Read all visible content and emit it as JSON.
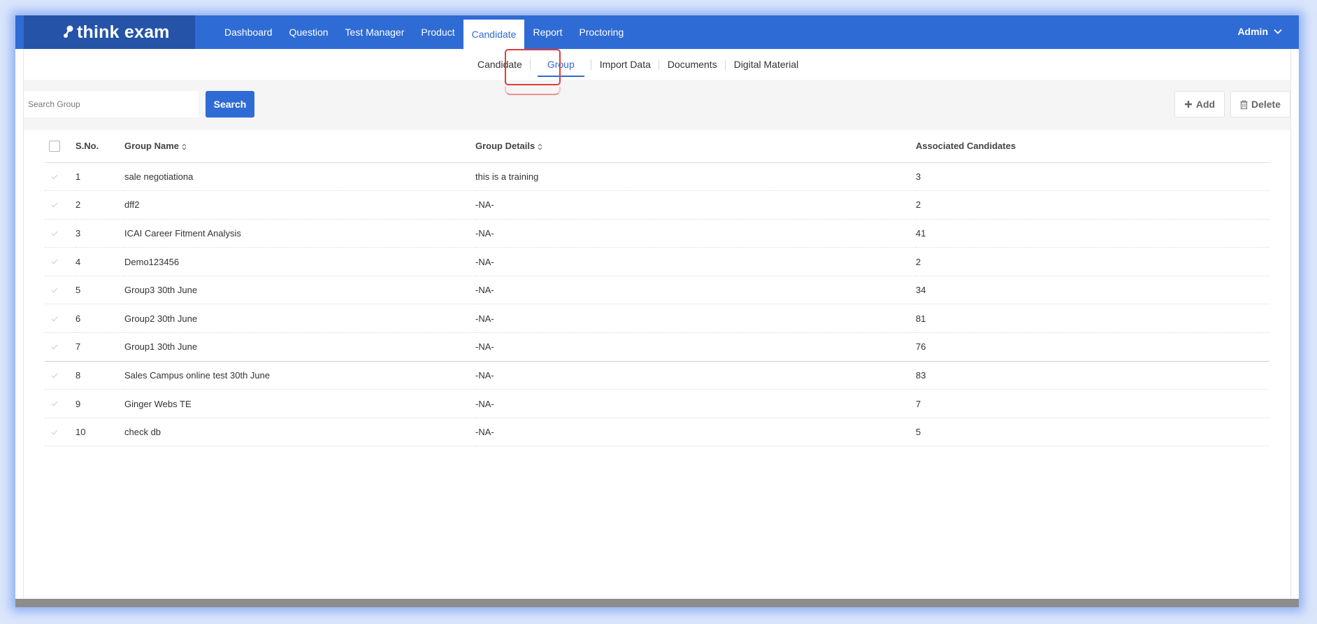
{
  "brand": {
    "name": "think exam"
  },
  "nav": {
    "items": [
      {
        "label": "Dashboard"
      },
      {
        "label": "Question"
      },
      {
        "label": "Test Manager"
      },
      {
        "label": "Product"
      },
      {
        "label": "Candidate"
      },
      {
        "label": "Report"
      },
      {
        "label": "Proctoring"
      }
    ],
    "active": "Candidate",
    "user": "Admin"
  },
  "subnav": {
    "items": [
      {
        "label": "Candidate"
      },
      {
        "label": "Group"
      },
      {
        "label": "Import Data"
      },
      {
        "label": "Documents"
      },
      {
        "label": "Digital Material"
      }
    ],
    "active": "Group"
  },
  "toolbar": {
    "search_placeholder": "Search Group",
    "search_label": "Search",
    "add_label": "Add",
    "delete_label": "Delete"
  },
  "table": {
    "headers": {
      "sno": "S.No.",
      "group_name": "Group Name",
      "group_details": "Group Details",
      "associated": "Associated Candidates"
    },
    "rows": [
      {
        "sno": "1",
        "name": "sale negotiationa",
        "details": "this is a training",
        "associated": "3"
      },
      {
        "sno": "2",
        "name": "dff2",
        "details": "-NA-",
        "associated": "2"
      },
      {
        "sno": "3",
        "name": "ICAI Career Fitment Analysis",
        "details": "-NA-",
        "associated": "41"
      },
      {
        "sno": "4",
        "name": "Demo123456",
        "details": "-NA-",
        "associated": "2"
      },
      {
        "sno": "5",
        "name": "Group3 30th June",
        "details": "-NA-",
        "associated": "34"
      },
      {
        "sno": "6",
        "name": "Group2 30th June",
        "details": "-NA-",
        "associated": "81"
      },
      {
        "sno": "7",
        "name": "Group1 30th June",
        "details": "-NA-",
        "associated": "76"
      },
      {
        "sno": "8",
        "name": "Sales Campus online test 30th June",
        "details": "-NA-",
        "associated": "83"
      },
      {
        "sno": "9",
        "name": "Ginger Webs TE",
        "details": "-NA-",
        "associated": "7"
      },
      {
        "sno": "10",
        "name": "check db",
        "details": "-NA-",
        "associated": "5"
      }
    ]
  },
  "colors": {
    "primary": "#2f6bd4",
    "logo_bg": "#2453a8",
    "highlight": "#e03c3c"
  },
  "icons": {
    "add": "plus-icon",
    "delete": "trash-icon",
    "sort": "sort-icon",
    "user_menu": "chevron-down-icon",
    "row_check": "check-icon"
  }
}
